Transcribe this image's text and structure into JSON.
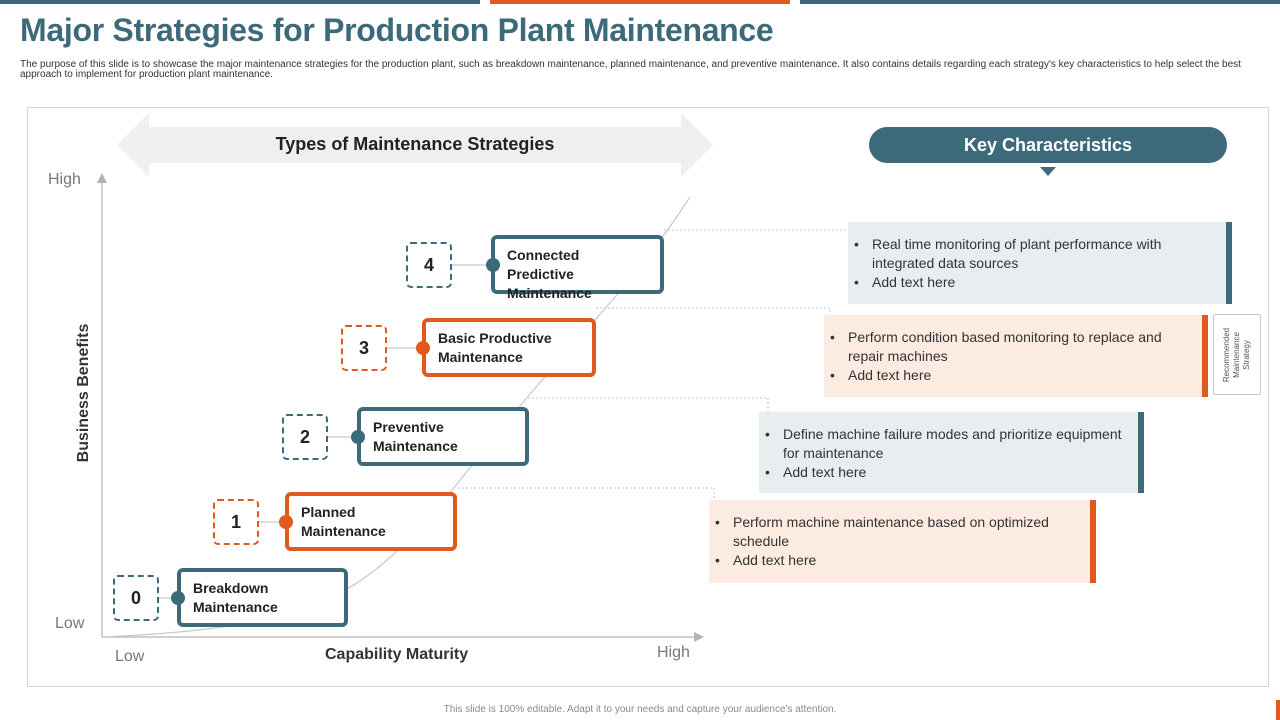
{
  "colors": {
    "teal": "#3d6a7b",
    "orange": "#e05a1b",
    "teal_box_bg": "#e8edf0",
    "orange_box_bg": "#fbebe1",
    "arrow_bg": "#efefef"
  },
  "header": {
    "title": "Major Strategies for Production Plant Maintenance",
    "subtitle": "The purpose of this slide is to showcase the major maintenance strategies for the production plant, such as breakdown maintenance, planned maintenance, and preventive maintenance. It also contains details regarding each strategy's key characteristics to help select the best approach to implement for production plant maintenance."
  },
  "diagram": {
    "types_label": "Types of Maintenance Strategies",
    "key_label": "Key Characteristics",
    "y_axis": {
      "title": "Business Benefits",
      "high": "High",
      "low": "Low"
    },
    "x_axis": {
      "title": "Capability Maturity",
      "high": "High",
      "low": "Low"
    },
    "strategies": [
      {
        "number": "0",
        "name": "Breakdown Maintenance",
        "color": "teal"
      },
      {
        "number": "1",
        "name": "Planned Maintenance",
        "color": "orange"
      },
      {
        "number": "2",
        "name": "Preventive Maintenance",
        "color": "teal"
      },
      {
        "number": "3",
        "name": "Basic Productive Maintenance",
        "color": "orange"
      },
      {
        "number": "4",
        "name": "Connected Predictive Maintenance",
        "color": "teal"
      }
    ],
    "characteristics": [
      {
        "points": [
          "Real time monitoring of plant performance with integrated data sources",
          "Add text here"
        ]
      },
      {
        "points": [
          "Perform condition based monitoring to replace and repair machines",
          "Add text here"
        ]
      },
      {
        "points": [
          "Define machine failure modes and prioritize equipment for maintenance",
          "Add text here"
        ]
      },
      {
        "points": [
          "Perform machine maintenance based on optimized schedule",
          "Add text here"
        ]
      }
    ],
    "recommended_label": "Recommended Maintenance Strategy"
  },
  "footer": {
    "text": "This slide is 100% editable. Adapt it to your needs and capture your audience's attention."
  }
}
